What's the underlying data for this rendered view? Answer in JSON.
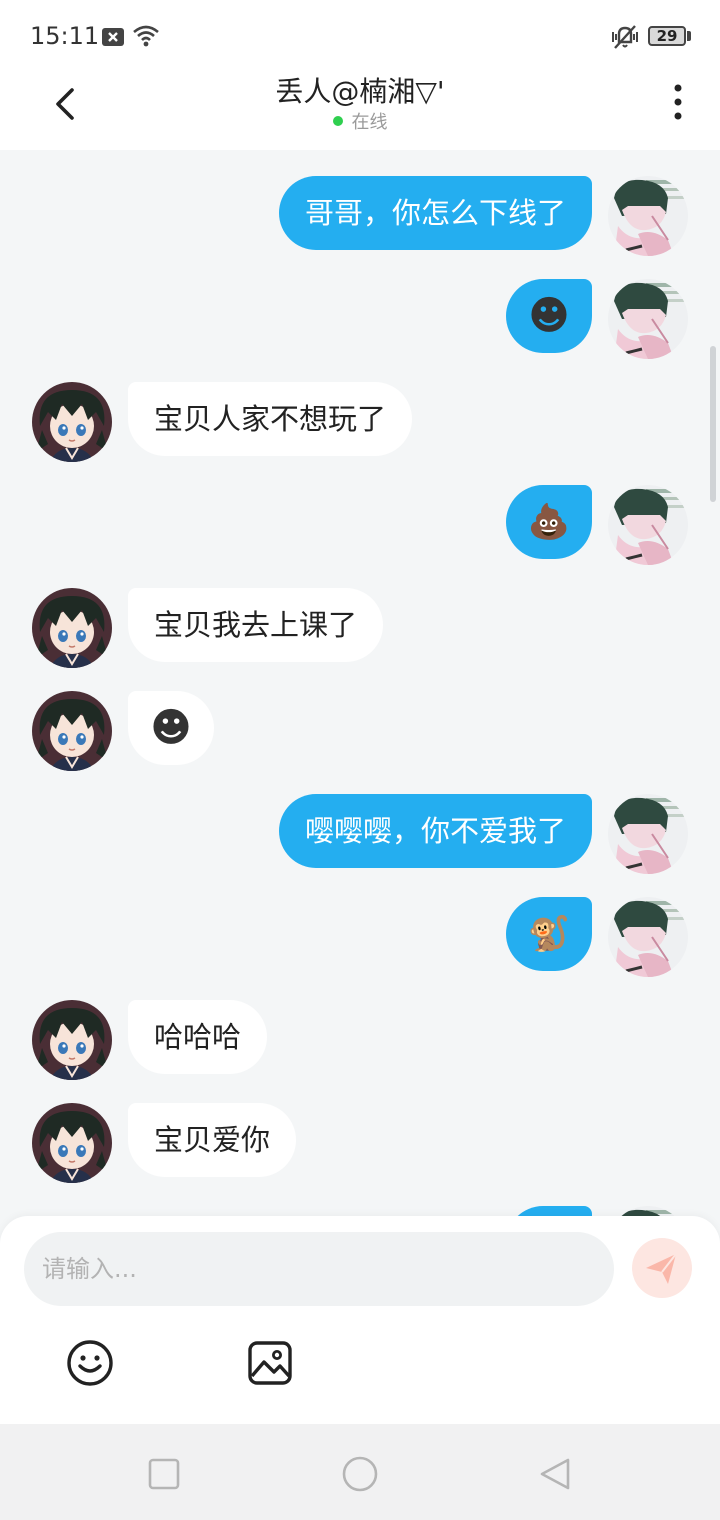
{
  "status": {
    "time": "15:11",
    "battery": "29"
  },
  "header": {
    "title": "丢人@楠湘▽'",
    "status": "在线"
  },
  "messages": [
    {
      "side": "me",
      "text": "哥哥，你怎么下线了"
    },
    {
      "side": "me",
      "emoji": "dark-smile-emoji",
      "glyph": "☻"
    },
    {
      "side": "other",
      "text": "宝贝人家不想玩了"
    },
    {
      "side": "me",
      "emoji": "poop-emoji",
      "glyph": "💩"
    },
    {
      "side": "other",
      "text": "宝贝我去上课了"
    },
    {
      "side": "other",
      "emoji": "dark-smile-emoji",
      "glyph": "☻"
    },
    {
      "side": "me",
      "text": "嘤嘤嘤，你不爱我了"
    },
    {
      "side": "me",
      "emoji": "monkey-emoji",
      "glyph": "🐒"
    },
    {
      "side": "other",
      "text": "哈哈哈"
    },
    {
      "side": "other",
      "text": "宝贝爱你"
    }
  ],
  "composer": {
    "placeholder": "请输入..."
  },
  "colors": {
    "accent": "#24aef0",
    "online": "#2fcf4f",
    "send_bg": "#fde6e1",
    "send_icon": "#fab7a9"
  },
  "icons": {
    "back": "chevron-left-icon",
    "menu": "more-vertical-icon",
    "emoji": "smile-icon",
    "image": "image-icon",
    "send": "send-icon"
  },
  "navbar": [
    "square-nav-icon",
    "circle-nav-icon",
    "triangle-back-nav-icon"
  ]
}
